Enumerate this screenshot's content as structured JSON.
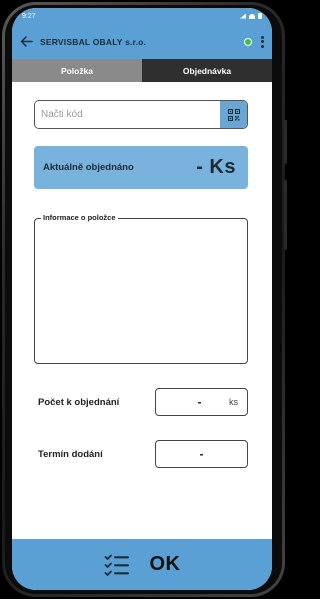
{
  "status_bar": {
    "time": "9:27"
  },
  "app_bar": {
    "title": "SERVISBAL OBALY s.r.o.",
    "connection_status_color": "#3bbf3b"
  },
  "tabs": [
    {
      "label": "Položka",
      "active": true
    },
    {
      "label": "Objednávka",
      "active": false
    }
  ],
  "code_input": {
    "placeholder": "Načti kód",
    "value": ""
  },
  "ordered": {
    "label": "Aktuálně objednáno",
    "value": "- Ks"
  },
  "item_info": {
    "legend": "Informace o položce",
    "content": ""
  },
  "order_quantity": {
    "label": "Počet k objednání",
    "value": "-",
    "unit": "ks"
  },
  "delivery_date": {
    "label": "Termín dodání",
    "value": "-"
  },
  "bottom_bar": {
    "ok_label": "OK",
    "list_icon": "checklist-icon"
  },
  "colors": {
    "accent": "#5aa0d4",
    "ordered_box": "#79b2dd",
    "tab_active": "#8a8a8a",
    "tab_inactive": "#2f2f2f"
  }
}
